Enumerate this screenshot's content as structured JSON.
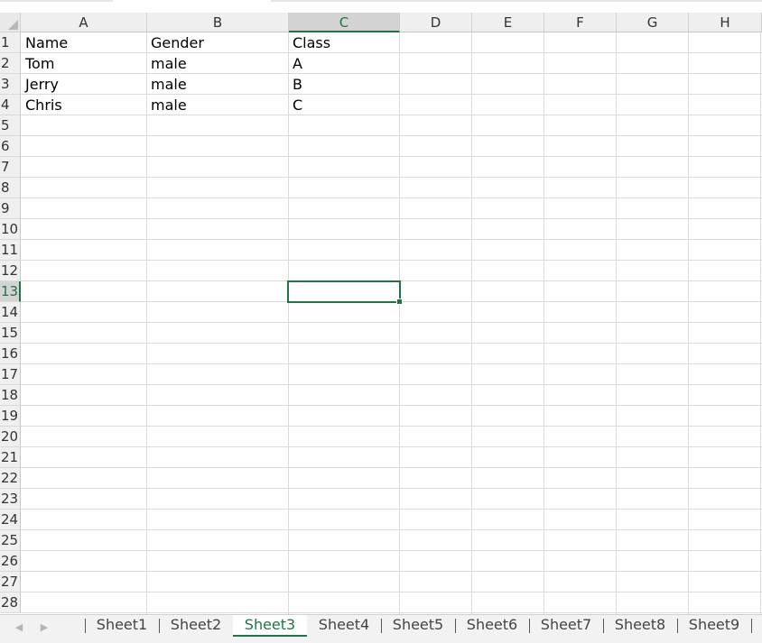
{
  "columns": [
    "A",
    "B",
    "C",
    "D",
    "E",
    "F",
    "G",
    "H"
  ],
  "rows": [
    "1",
    "2",
    "3",
    "4",
    "5",
    "6",
    "7",
    "8",
    "9",
    "10",
    "11",
    "12",
    "13",
    "14",
    "15",
    "16",
    "17",
    "18",
    "19",
    "20",
    "21",
    "22",
    "23",
    "24",
    "25",
    "26",
    "27",
    "28"
  ],
  "selection": {
    "column": "C",
    "row": "13"
  },
  "table": {
    "header": [
      "Name",
      "Gender",
      "Class"
    ],
    "records": [
      [
        "Tom",
        "male",
        "A"
      ],
      [
        "Jerry",
        "male",
        "B"
      ],
      [
        "Chris",
        "male",
        "C"
      ]
    ]
  },
  "sheet_tabs": {
    "nav_prev": "◀",
    "nav_next": "▶",
    "tabs": [
      "Sheet1",
      "Sheet2",
      "Sheet3",
      "Sheet4",
      "Sheet5",
      "Sheet6",
      "Sheet7",
      "Sheet8",
      "Sheet9"
    ],
    "active": "Sheet3"
  },
  "colors": {
    "accent": "#217346",
    "header_bg": "#efefef",
    "selected_header_bg": "#d3d3d3",
    "gridline": "#dadada"
  }
}
